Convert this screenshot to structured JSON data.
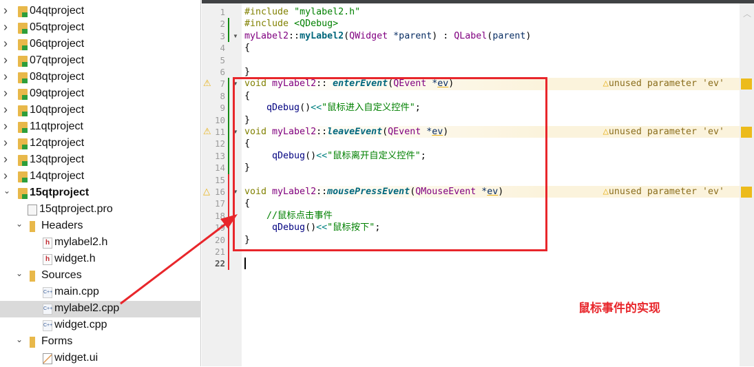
{
  "tree": [
    {
      "label": "04qtproject",
      "level": 0,
      "kind": "project",
      "chev": "›"
    },
    {
      "label": "05qtproject",
      "level": 0,
      "kind": "project",
      "chev": "›"
    },
    {
      "label": "06qtproject",
      "level": 0,
      "kind": "project",
      "chev": "›"
    },
    {
      "label": "07qtproject",
      "level": 0,
      "kind": "project",
      "chev": "›"
    },
    {
      "label": "08qtproject",
      "level": 0,
      "kind": "project",
      "chev": "›"
    },
    {
      "label": "09qtproject",
      "level": 0,
      "kind": "project",
      "chev": "›"
    },
    {
      "label": "10qtproject",
      "level": 0,
      "kind": "project",
      "chev": "›"
    },
    {
      "label": "11qtproject",
      "level": 0,
      "kind": "project",
      "chev": "›"
    },
    {
      "label": "12qtproject",
      "level": 0,
      "kind": "project",
      "chev": "›"
    },
    {
      "label": "13qtproject",
      "level": 0,
      "kind": "project",
      "chev": "›"
    },
    {
      "label": "14qtproject",
      "level": 0,
      "kind": "project",
      "chev": "›"
    },
    {
      "label": "15qtproject",
      "level": 0,
      "kind": "project",
      "chev": "⌄",
      "bold": true
    },
    {
      "label": "15qtproject.pro",
      "level": 1,
      "kind": "pro"
    },
    {
      "label": "Headers",
      "level": 1,
      "kind": "hfolder",
      "chev": "⌄"
    },
    {
      "label": "mylabel2.h",
      "level": 2,
      "kind": "h"
    },
    {
      "label": "widget.h",
      "level": 2,
      "kind": "h"
    },
    {
      "label": "Sources",
      "level": 1,
      "kind": "cfolder",
      "chev": "⌄"
    },
    {
      "label": "main.cpp",
      "level": 2,
      "kind": "cpp"
    },
    {
      "label": "mylabel2.cpp",
      "level": 2,
      "kind": "cpp",
      "selected": true
    },
    {
      "label": "widget.cpp",
      "level": 2,
      "kind": "cpp"
    },
    {
      "label": "Forms",
      "level": 1,
      "kind": "ffolder",
      "chev": "⌄"
    },
    {
      "label": "widget.ui",
      "level": 2,
      "kind": "ui"
    }
  ],
  "editor": {
    "lines": [
      [
        {
          "t": "#include ",
          "c": "kw"
        },
        {
          "t": "\"mylabel2.h\"",
          "c": "str"
        }
      ],
      [
        {
          "t": "#include ",
          "c": "kw"
        },
        {
          "t": "<QDebug>",
          "c": "str"
        }
      ],
      [
        {
          "t": "myLabel2",
          "c": "cls"
        },
        {
          "t": "::"
        },
        {
          "t": "myLabel2",
          "c": "fn2"
        },
        {
          "t": "("
        },
        {
          "t": "QWidget",
          "c": "cls"
        },
        {
          "t": " *parent",
          "c": "par"
        },
        {
          "t": ") : "
        },
        {
          "t": "QLabel",
          "c": "cls"
        },
        {
          "t": "("
        },
        {
          "t": "parent",
          "c": "par"
        },
        {
          "t": ")"
        }
      ],
      [
        {
          "t": "{"
        }
      ],
      [],
      [
        {
          "t": "}"
        }
      ],
      [
        {
          "t": "void ",
          "c": "kw"
        },
        {
          "t": "myLabel2",
          "c": "cls"
        },
        {
          "t": ":: "
        },
        {
          "t": "enterEvent",
          "c": "fn"
        },
        {
          "t": "("
        },
        {
          "t": "QEvent",
          "c": "cls"
        },
        {
          "t": " *",
          "c": "par"
        },
        {
          "t": "ev",
          "c": "ul"
        },
        {
          "t": ")"
        }
      ],
      [
        {
          "t": "{"
        }
      ],
      [
        {
          "t": "    "
        },
        {
          "t": "qDebug",
          "c": "dbg"
        },
        {
          "t": "()"
        },
        {
          "t": "<<",
          "c": "op"
        },
        {
          "t": "\"鼠标进入自定义控件\"",
          "c": "str"
        },
        {
          "t": ";"
        }
      ],
      [
        {
          "t": "}"
        }
      ],
      [
        {
          "t": "void ",
          "c": "kw"
        },
        {
          "t": "myLabel2",
          "c": "cls"
        },
        {
          "t": "::"
        },
        {
          "t": "leaveEvent",
          "c": "fn"
        },
        {
          "t": "("
        },
        {
          "t": "QEvent",
          "c": "cls"
        },
        {
          "t": " *",
          "c": "par"
        },
        {
          "t": "ev",
          "c": "ul"
        },
        {
          "t": ")"
        }
      ],
      [
        {
          "t": "{"
        }
      ],
      [
        {
          "t": "     "
        },
        {
          "t": "qDebug",
          "c": "dbg"
        },
        {
          "t": "()"
        },
        {
          "t": "<<",
          "c": "op"
        },
        {
          "t": "\"鼠标离开自定义控件\"",
          "c": "str"
        },
        {
          "t": ";"
        }
      ],
      [
        {
          "t": "}"
        }
      ],
      [],
      [
        {
          "t": "void ",
          "c": "kw"
        },
        {
          "t": "myLabel2",
          "c": "cls"
        },
        {
          "t": "::"
        },
        {
          "t": "mousePressEvent",
          "c": "fn"
        },
        {
          "t": "("
        },
        {
          "t": "QMouseEvent",
          "c": "cls"
        },
        {
          "t": " *",
          "c": "par"
        },
        {
          "t": "ev",
          "c": "ul"
        },
        {
          "t": ")"
        }
      ],
      [
        {
          "t": "{"
        }
      ],
      [
        {
          "t": "    "
        },
        {
          "t": "//鼠标点击事件",
          "c": "cmt"
        }
      ],
      [
        {
          "t": "     "
        },
        {
          "t": "qDebug",
          "c": "dbg"
        },
        {
          "t": "()"
        },
        {
          "t": "<<",
          "c": "op"
        },
        {
          "t": "\"鼠标按下\"",
          "c": "str"
        },
        {
          "t": ";"
        }
      ],
      [
        {
          "t": "}"
        }
      ],
      [],
      []
    ],
    "current_line": 22,
    "warnings": [
      {
        "line": 7,
        "text": "unused parameter 'ev'",
        "icon": "warning-filled"
      },
      {
        "line": 11,
        "text": "unused parameter 'ev'",
        "icon": "warning-filled"
      },
      {
        "line": 16,
        "text": "unused parameter 'ev'",
        "icon": "warning-outline"
      }
    ],
    "fold_lines": [
      3,
      7,
      11,
      16
    ],
    "changed_green": [
      [
        2,
        3
      ],
      [
        7,
        14
      ]
    ],
    "changed_red": [
      [
        15,
        22
      ]
    ]
  },
  "annotation": {
    "text": "鼠标事件的实现",
    "color": "#e8262b"
  }
}
